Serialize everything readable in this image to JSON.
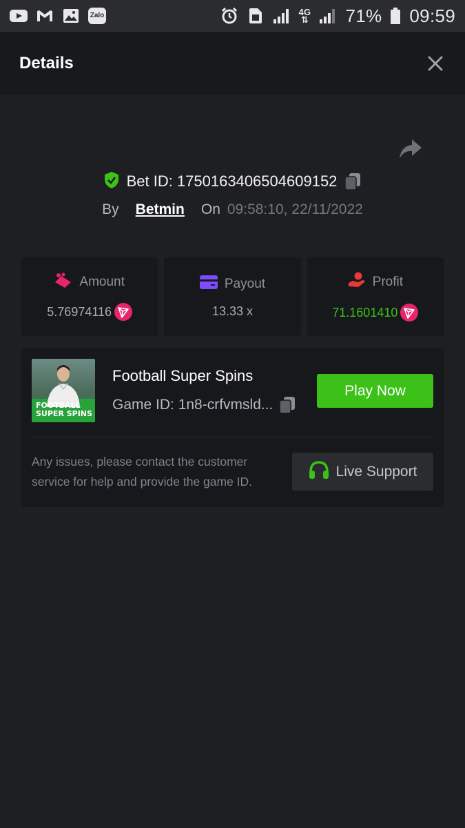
{
  "status_bar": {
    "left_icons": [
      "youtube-icon",
      "gmail-icon",
      "gallery-icon",
      "zalo-icon"
    ],
    "zalo_label": "Zalo",
    "right_icons": [
      "alarm-icon",
      "sim-icon",
      "signal-icon",
      "network-4g-icon",
      "signal-icon",
      "battery-icon"
    ],
    "network_label": "4G",
    "battery": "71%",
    "time": "09:59"
  },
  "header": {
    "title": "Details",
    "close_icon": "close-icon"
  },
  "bet": {
    "share_icon": "share-icon",
    "id_label": "Bet ID: 1750163406504609152",
    "by_label": "By",
    "user": "Betmin",
    "on_label": "On",
    "datetime": "09:58:10, 22/11/2022"
  },
  "stats": [
    {
      "icon": "amount-icon",
      "label": "Amount",
      "value": "5.76974116",
      "coin": "trx-coin-icon",
      "color": "#e8256b"
    },
    {
      "icon": "payout-icon",
      "label": "Payout",
      "value": "13.33 x",
      "color": "#7b4dff"
    },
    {
      "icon": "profit-icon",
      "label": "Profit",
      "value": "71.1601410",
      "coin": "trx-coin-icon",
      "color": "#e8393b"
    }
  ],
  "game": {
    "thumb_line1": "FOOTBALL",
    "thumb_line2": "SUPER SPINS",
    "title": "Football Super Spins",
    "id_label": "Game ID: 1n8-crfvmsld...",
    "play_label": "Play Now",
    "notice": "Any issues, please contact the customer service for help and provide the game ID.",
    "support_label": "Live Support",
    "support_icon": "headset-icon"
  },
  "colors": {
    "accent_green": "#3bc117",
    "background": "#1e1f23",
    "card": "#17181b"
  }
}
